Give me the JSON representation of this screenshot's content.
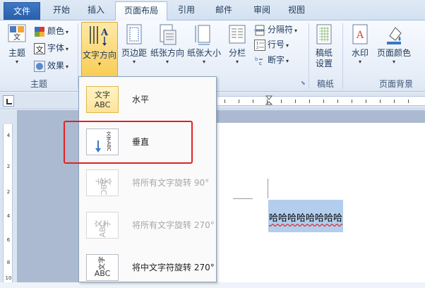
{
  "tabs": [
    {
      "label": "文件",
      "type": "file"
    },
    {
      "label": "开始",
      "type": "normal"
    },
    {
      "label": "插入",
      "type": "normal"
    },
    {
      "label": "页面布局",
      "type": "active"
    },
    {
      "label": "引用",
      "type": "normal"
    },
    {
      "label": "邮件",
      "type": "normal"
    },
    {
      "label": "审阅",
      "type": "normal"
    },
    {
      "label": "视图",
      "type": "normal"
    }
  ],
  "ribbon": {
    "theme_group": {
      "themes_label": "主题",
      "colors_label": "颜色",
      "fonts_label": "字体",
      "effects_label": "效果",
      "group_label": "主题"
    },
    "page_setup": {
      "text_direction_label": "文字方向",
      "margins_label": "页边距",
      "orientation_label": "纸张方向",
      "size_label": "纸张大小",
      "columns_label": "分栏",
      "breaks_label": "分隔符",
      "line_numbers_label": "行号",
      "hyphenation_label": "断字"
    },
    "draft": {
      "draft_paper_label_line1": "稿纸",
      "draft_paper_label_line2": "设置",
      "group_label": "稿纸"
    },
    "page_background": {
      "watermark_label": "水印",
      "page_color_label": "页面颜色",
      "group_label": "页面背景"
    }
  },
  "text_direction_menu": {
    "items": [
      {
        "label": "水平",
        "thumb_line1": "文字",
        "thumb_line2": "ABC",
        "enabled": true
      },
      {
        "label": "垂直",
        "thumb_line1": "文字ABC",
        "thumb_line2": "",
        "enabled": true
      },
      {
        "label": "将所有文字旋转 90°",
        "thumb_line1": "文字",
        "thumb_line2": "ABC",
        "enabled": false
      },
      {
        "label": "将所有文字旋转 270°",
        "thumb_line1": "文字",
        "thumb_line2": "ABC",
        "enabled": false
      },
      {
        "label": "将中文字符旋转 270°",
        "thumb_line1": "文字",
        "thumb_line2": "ABC",
        "enabled": true
      }
    ]
  },
  "ruler": {
    "vertical_numbers": [
      "4",
      "2",
      "2",
      "4",
      "6",
      "8",
      "10"
    ]
  },
  "document": {
    "selected_text": "哈哈哈哈哈哈哈哈"
  },
  "colors": {
    "file_tab": "#2a5ea8",
    "selection": "#b3cdec",
    "highlight_box": "#e02222"
  }
}
